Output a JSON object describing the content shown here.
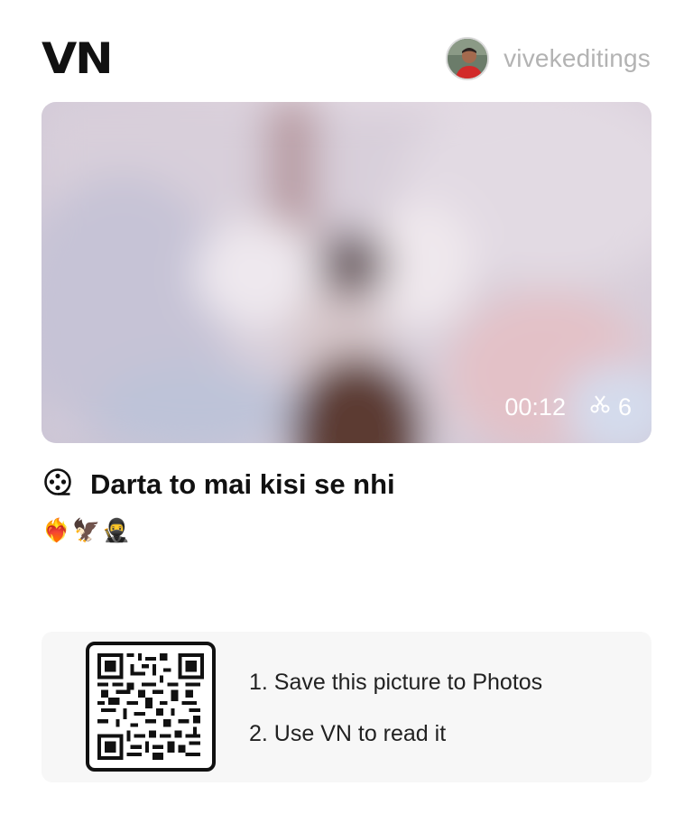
{
  "header": {
    "logo_text": "VN",
    "username": "vivekeditings"
  },
  "video": {
    "duration": "00:12",
    "clip_count": "6"
  },
  "project": {
    "title": "Darta to mai kisi se nhi",
    "emojis": [
      "❤️‍🔥",
      "🦅",
      "🥷"
    ]
  },
  "qr_panel": {
    "step1": "1. Save this picture to Photos",
    "step2": "2. Use VN to read it"
  },
  "icons": {
    "film_reel": "film-reel-icon",
    "scissors": "scissors-icon",
    "qr": "qr-code"
  },
  "colors": {
    "text": "#111111",
    "muted": "#b3b3b3",
    "panel_bg": "#f7f7f7"
  }
}
